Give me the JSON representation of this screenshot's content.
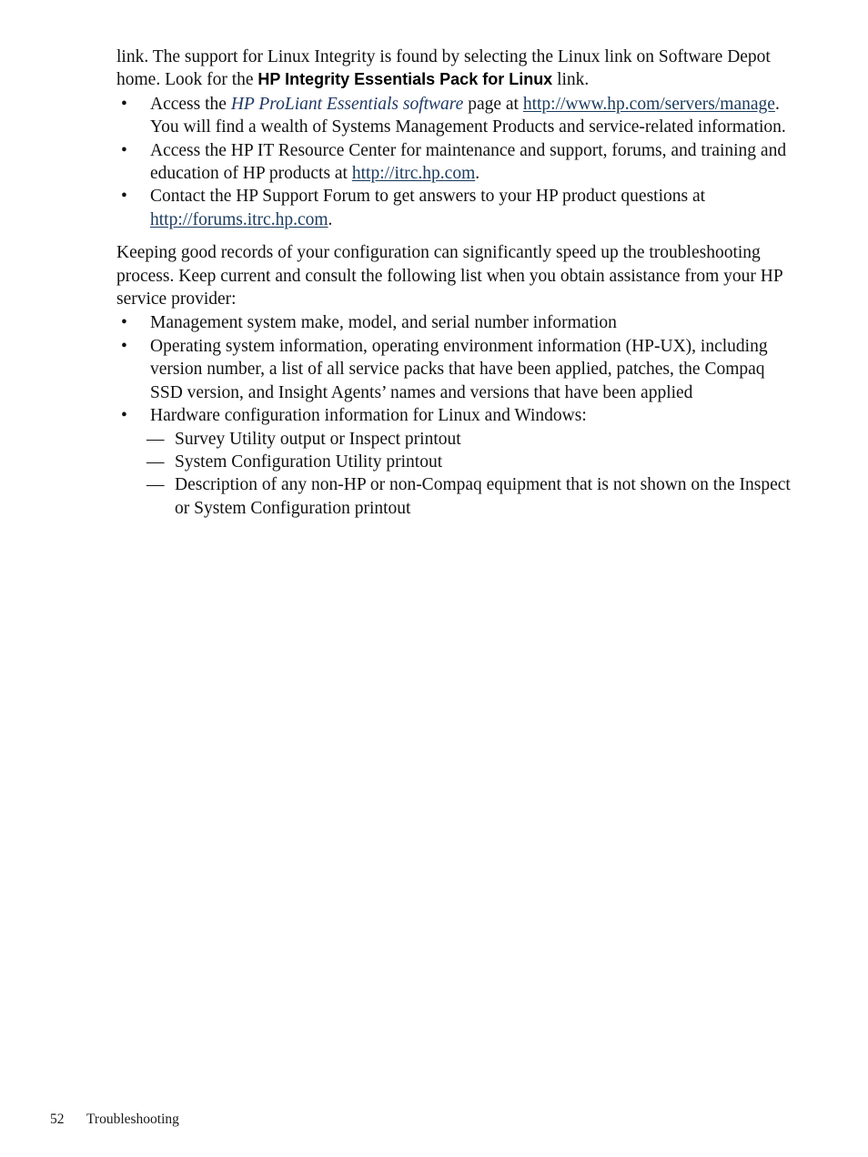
{
  "document": {
    "body": {
      "intro_paragraph": {
        "text_before_bold": "link. The support for Linux Integrity is found by selecting the Linux link on Software Depot home. Look for the ",
        "bold_text": "HP Integrity Essentials Pack for Linux",
        "text_after_bold": " link."
      },
      "resources_list": {
        "bullet_glyph": "•",
        "items": [
          {
            "segments": [
              {
                "kind": "text",
                "value": "Access the "
              },
              {
                "kind": "xref",
                "value": "HP ProLiant Essentials software"
              },
              {
                "kind": "text",
                "value": " page at "
              },
              {
                "kind": "link",
                "value": "http://www.hp.com/servers/manage"
              },
              {
                "kind": "text",
                "value": ". You will find a wealth of Systems Management Products and service-related information."
              }
            ]
          },
          {
            "segments": [
              {
                "kind": "text",
                "value": "Access the HP IT Resource Center for maintenance and support, forums, and training and education of HP products at "
              },
              {
                "kind": "link",
                "value": "http://itrc.hp.com"
              },
              {
                "kind": "text",
                "value": "."
              }
            ]
          },
          {
            "segments": [
              {
                "kind": "text",
                "value": "Contact the HP Support Forum to get answers to your HP product questions at "
              },
              {
                "kind": "link",
                "value": "http://forums.itrc.hp.com"
              },
              {
                "kind": "text",
                "value": "."
              }
            ]
          }
        ]
      },
      "records_paragraph": "Keeping good records of your configuration can significantly speed up the troubleshooting process. Keep current and consult the following list when you obtain assistance from your HP service provider:",
      "records_list": {
        "bullet_glyph": "•",
        "items": [
          {
            "text": "Management system make, model, and serial number information"
          },
          {
            "text": "Operating system information, operating environment information (HP-UX), including version number, a list of all service packs that have been applied, patches, the Compaq SSD version, and Insight Agents’ names and versions that have been applied"
          },
          {
            "text": "Hardware configuration information for Linux and Windows:"
          }
        ]
      },
      "hardware_sublist": {
        "dash_glyph": "—",
        "items": [
          {
            "text": "Survey Utility output or Inspect printout"
          },
          {
            "text": "System Configuration Utility printout"
          },
          {
            "text": "Description of any non-HP or non-Compaq equipment that is not shown on the Inspect or System Configuration printout"
          }
        ]
      }
    },
    "footer": {
      "page_number": "52",
      "chapter_title": "Troubleshooting"
    },
    "colors": {
      "link": "#1a3a5c",
      "cross_reference": "#1f3864",
      "body_text": "#121212",
      "page_background": "#ffffff"
    }
  }
}
